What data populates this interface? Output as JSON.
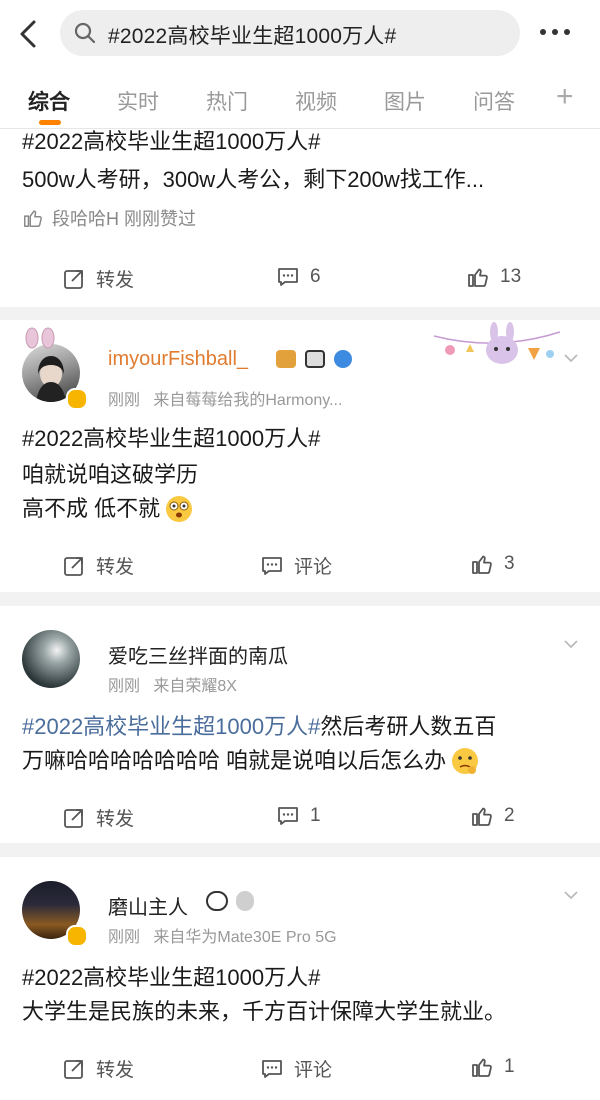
{
  "search": {
    "query": "#2022高校毕业生超1000万人#"
  },
  "tabs": [
    "综合",
    "实时",
    "热门",
    "视频",
    "图片",
    "问答"
  ],
  "posts": [
    {
      "topic": "#2022高校毕业生超1000万人#",
      "line1": "500w人考研，300w人考公，剩下200w找工作...",
      "liked_by": "段哈哈H 刚刚赞过",
      "repost_label": "转发",
      "comment": "6",
      "like": "13"
    },
    {
      "user": "imyourFishball_",
      "time": "刚刚",
      "source": "来自莓莓给我的Harmony...",
      "topic": "#2022高校毕业生超1000万人#",
      "line1": "咱就说咱这破学历",
      "line2": "高不成 低不就",
      "repost_label": "转发",
      "comment_label": "评论",
      "like": "3"
    },
    {
      "user": "爱吃三丝拌面的南瓜",
      "time": "刚刚",
      "source": "来自荣耀8X",
      "topic": "#2022高校毕业生超1000万人#",
      "line1_rest": "然后考研人数五百",
      "line2": "万嘛哈哈哈哈哈哈哈 咱就是说咱以后怎么办",
      "repost_label": "转发",
      "comment": "1",
      "like": "2"
    },
    {
      "user": "磨山主人",
      "time": "刚刚",
      "source": "来自华为Mate30E Pro 5G",
      "topic": "#2022高校毕业生超1000万人#",
      "line1": "大学生是民族的未来，千方百计保障大学生就业。",
      "repost_label": "转发",
      "comment_label": "评论",
      "like": "1"
    }
  ],
  "colors": {
    "accent": "#ff8200",
    "topic": "#4a6d9c",
    "background": "#f2f2f2"
  }
}
